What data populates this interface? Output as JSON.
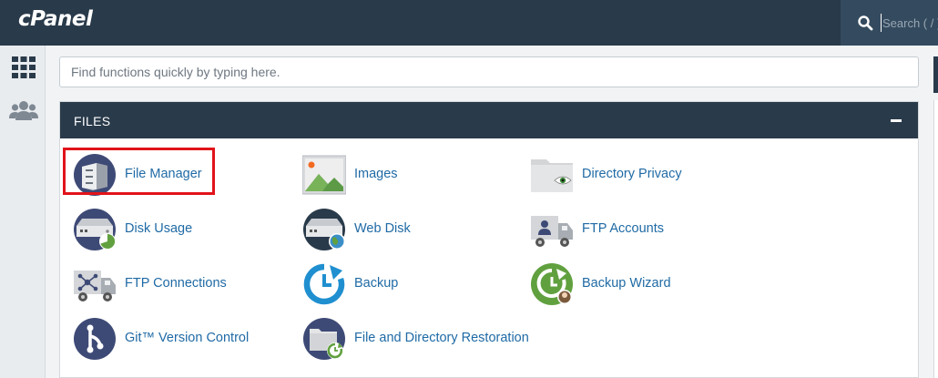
{
  "app": {
    "logo": "cPanel"
  },
  "header": {
    "search_placeholder": "Search ( / )"
  },
  "sidebar": {
    "icons": [
      "grid-icon",
      "users-icon"
    ]
  },
  "main": {
    "quick_search_placeholder": "Find functions quickly by typing here.",
    "section": {
      "title": "FILES",
      "items": [
        {
          "label": "File Manager",
          "icon": "file-cabinet-icon"
        },
        {
          "label": "Images",
          "icon": "image-icon"
        },
        {
          "label": "Directory Privacy",
          "icon": "folder-eye-icon"
        },
        {
          "label": "Disk Usage",
          "icon": "disk-usage-icon"
        },
        {
          "label": "Web Disk",
          "icon": "web-disk-icon"
        },
        {
          "label": "FTP Accounts",
          "icon": "ftp-accounts-icon"
        },
        {
          "label": "FTP Connections",
          "icon": "ftp-connections-icon"
        },
        {
          "label": "Backup",
          "icon": "backup-icon"
        },
        {
          "label": "Backup Wizard",
          "icon": "backup-wizard-icon"
        },
        {
          "label": "Git™ Version Control",
          "icon": "git-icon"
        },
        {
          "label": "File and Directory Restoration",
          "icon": "restore-icon"
        }
      ]
    }
  },
  "colors": {
    "header_bg": "#293a4a",
    "link": "#1f6aa5",
    "highlight": "#e1131a"
  }
}
